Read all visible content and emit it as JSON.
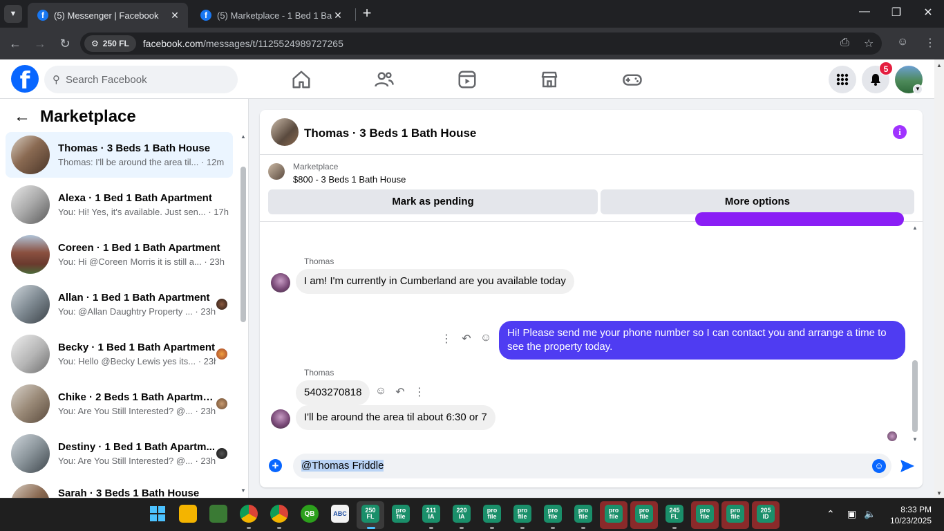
{
  "browser": {
    "tabs": [
      {
        "title": "(5) Messenger | Facebook",
        "active": true
      },
      {
        "title": "(5) Marketplace - 1 Bed 1 Bath A",
        "active": false
      }
    ],
    "site_chip": "250 FL",
    "url_domain": "facebook.com",
    "url_path": "/messages/t/1125524989727265"
  },
  "fb": {
    "search_placeholder": "Search Facebook",
    "notifications_count": "5"
  },
  "left": {
    "title": "Marketplace",
    "conversations": [
      {
        "name": "Thomas · 3 Beds 1 Bath House",
        "preview": "Thomas: I'll be around the area til... · 12m"
      },
      {
        "name": "Alexa · 1 Bed 1 Bath Apartment",
        "preview": "You: Hi! Yes, it's available. Just sen... · 17h"
      },
      {
        "name": "Coreen · 1 Bed 1 Bath Apartment",
        "preview": "You: Hi @Coreen Morris it is still a... · 23h"
      },
      {
        "name": "Allan · 1 Bed 1 Bath Apartment",
        "preview": "You: @Allan Daughtry Property ... · 23h"
      },
      {
        "name": "Becky · 1 Bed 1 Bath Apartment",
        "preview": "You: Hello @Becky Lewis yes its... · 23h"
      },
      {
        "name": "Chike · 2 Beds 1 Bath Apartme...",
        "preview": "You: Are You Still Interested? @... · 23h"
      },
      {
        "name": "Destiny · 1 Bed 1 Bath Apartm...",
        "preview": "You: Are You Still Interested? @... · 23h"
      },
      {
        "name": "Sarah · 3 Beds 1 Bath House",
        "preview": ""
      }
    ]
  },
  "chat": {
    "title": "Thomas · 3 Beds 1 Bath House",
    "marketplace_label": "Marketplace",
    "listing": "$800 - 3 Beds 1 Bath House",
    "mark_pending": "Mark as pending",
    "more_options": "More options",
    "messages": [
      {
        "from": "Thomas",
        "text": "I am! I'm currently in Cumberland are you available today"
      },
      {
        "from": "You",
        "text": "Hi! Please send me your phone number so I can contact you and arrange a time to see the property today."
      },
      {
        "from": "Thomas",
        "text": "5403270818"
      },
      {
        "from": "Thomas",
        "text": "I'll be around the area til about 6:30 or 7"
      }
    ],
    "sender_name": "Thomas",
    "composer_value": "@Thomas Friddle"
  },
  "taskbar": {
    "apps": [
      "Start",
      "File Explorer",
      "Notepad",
      "Chrome",
      "Chrome",
      "QuickBooks",
      "ABC",
      "250 FL",
      "pro file",
      "211 IA",
      "220 IA",
      "pro file",
      "pro file",
      "pro file",
      "pro file",
      "pro file",
      "pro file",
      "245 FL",
      "pro file",
      "pro file",
      "205 ID"
    ],
    "time": "8:33 PM",
    "date": "10/23/2025"
  },
  "colors": {
    "fb_blue": "#0866ff",
    "outgoing_bubble": "#4f3cf2",
    "selected_conversation": "#ebf5ff",
    "taskbar_green": "#1a8f6a",
    "taskbar_red": "#c0392b"
  }
}
